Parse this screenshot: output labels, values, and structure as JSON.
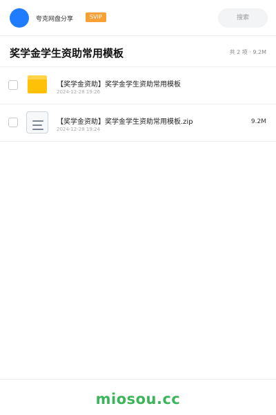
{
  "header": {
    "username": "夸克网盘分享",
    "badge": "SVIP",
    "search_placeholder": "搜索",
    "avatar_color": "#1f7cff"
  },
  "title_bar": {
    "title": "奖学金学生资助常用模板",
    "summary": "共 2 项 · 9.2M"
  },
  "files": [
    {
      "name": "【奖学金资助】奖学金学生资助常用模板",
      "date": "2024-12-28 19:26",
      "size": "",
      "icon": "folder-icon"
    },
    {
      "name": "【奖学金资助】奖学金学生资助常用模板.zip",
      "date": "2024-12-28 19:24",
      "size": "9.2M",
      "icon": "zip-file-icon"
    }
  ],
  "footer": {
    "brand": "miosou.cc",
    "brand_color": "#3cb55a"
  }
}
